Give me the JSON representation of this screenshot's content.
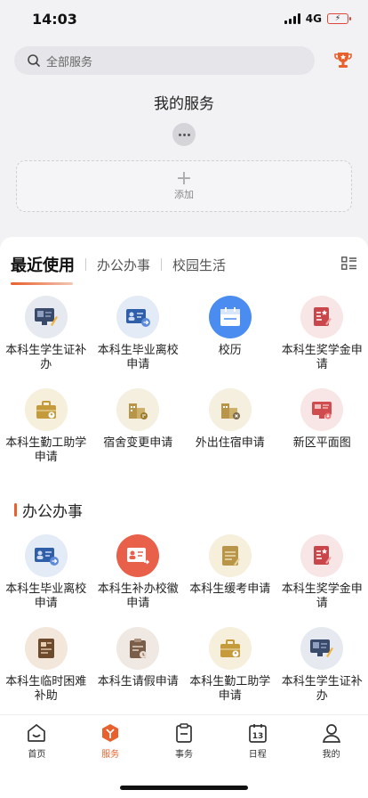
{
  "status_bar": {
    "time": "14:03",
    "network": "4G"
  },
  "search": {
    "placeholder": "全部服务"
  },
  "my_services": {
    "title": "我的服务",
    "add_label": "添加"
  },
  "tabs": [
    "最近使用",
    "办公办事",
    "校园生活"
  ],
  "recent": [
    {
      "label": "本科生学生证补办",
      "icon": "id-card-board-icon"
    },
    {
      "label": "本科生毕业离校申请",
      "icon": "id-card-arrow-icon"
    },
    {
      "label": "校历",
      "icon": "calendar-icon"
    },
    {
      "label": "本科生奖学金申请",
      "icon": "scholarship-doc-icon"
    },
    {
      "label": "本科生勤工助学申请",
      "icon": "briefcase-icon"
    },
    {
      "label": "宿舍变更申请",
      "icon": "dorm-swap-icon"
    },
    {
      "label": "外出住宿申请",
      "icon": "dorm-out-icon"
    },
    {
      "label": "新区平面图",
      "icon": "map-board-icon"
    }
  ],
  "office": {
    "title": "办公办事",
    "items": [
      {
        "label": "本科生毕业离校申请",
        "icon": "id-card-arrow-icon"
      },
      {
        "label": "本科生补办校徽申请",
        "icon": "badge-reissue-icon"
      },
      {
        "label": "本科生缓考申请",
        "icon": "exam-defer-icon"
      },
      {
        "label": "本科生奖学金申请",
        "icon": "scholarship-doc-icon"
      },
      {
        "label": "本科生临时困难补助",
        "icon": "hardship-doc-icon"
      },
      {
        "label": "本科生请假申请",
        "icon": "leave-clipboard-icon"
      },
      {
        "label": "本科生勤工助学申请",
        "icon": "briefcase-icon"
      },
      {
        "label": "本科生学生证补办",
        "icon": "id-card-board-icon"
      }
    ]
  },
  "nav": [
    {
      "label": "首页",
      "icon": "home-icon",
      "active": false
    },
    {
      "label": "服务",
      "icon": "service-cube-icon",
      "active": true
    },
    {
      "label": "事务",
      "icon": "clipboard-icon",
      "active": false
    },
    {
      "label": "日程",
      "icon": "schedule-icon",
      "active": false
    },
    {
      "label": "我的",
      "icon": "profile-icon",
      "active": false
    }
  ],
  "colors": {
    "accent": "#e8602c",
    "panel": "#ffffff",
    "page_bg": "#f2f2f4"
  }
}
